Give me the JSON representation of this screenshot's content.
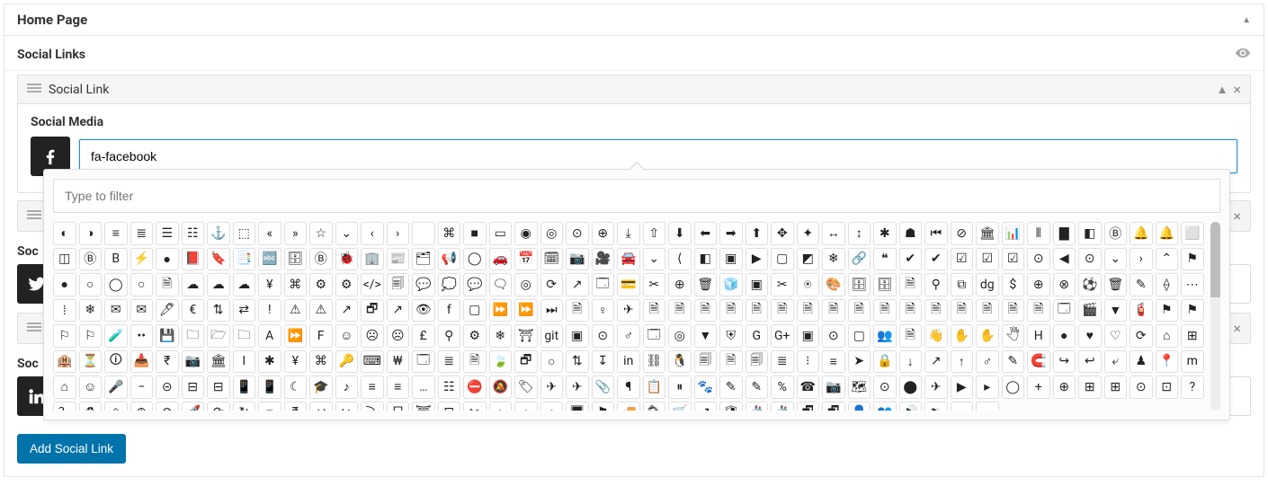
{
  "page": {
    "title": "Home Page"
  },
  "section": {
    "title": "Social Links"
  },
  "rows": {
    "r0": {
      "title": "Social Link",
      "field_label": "Social Media",
      "value": "fa-facebook",
      "icon": "facebook"
    },
    "r1": {
      "title": "Soc",
      "field_label": "Soc",
      "icon": "twitter"
    },
    "r2": {
      "title": "Soc",
      "field_label": "Soc",
      "icon": "linkedin"
    }
  },
  "picker": {
    "filter_placeholder": "Type to filter"
  },
  "buttons": {
    "add": "Add Social Link"
  }
}
